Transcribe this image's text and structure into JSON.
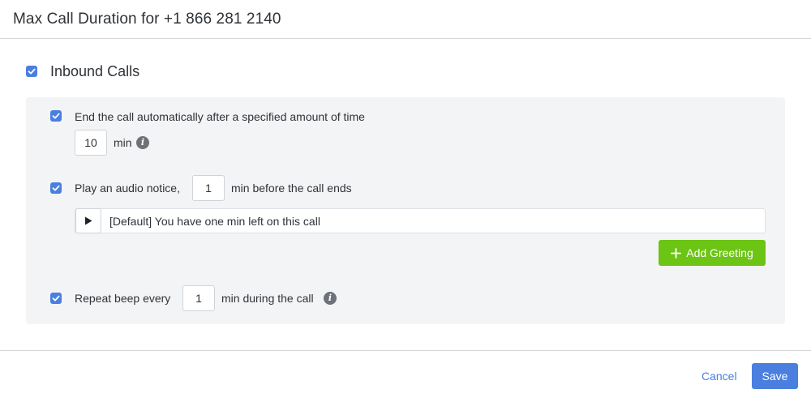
{
  "dialog": {
    "title": "Max Call Duration for +1 866 281 2140"
  },
  "inbound": {
    "label": "Inbound Calls",
    "checked": true
  },
  "end_call": {
    "label": "End the call automatically after a specified amount of time",
    "checked": true,
    "value": "10",
    "unit": "min"
  },
  "audio_notice": {
    "label_before": "Play an audio notice,",
    "value": "1",
    "label_after": "min before the call ends",
    "checked": true,
    "greeting": "[Default] You have one min left on this call",
    "add_greeting_label": "Add Greeting"
  },
  "repeat_beep": {
    "label_before": "Repeat beep every",
    "value": "1",
    "label_after": "min during the call",
    "checked": true
  },
  "footer": {
    "cancel_label": "Cancel",
    "save_label": "Save"
  },
  "icons": {
    "checkbox": "check-icon",
    "info": "info-icon",
    "play": "play-icon",
    "add": "plus-icon"
  },
  "colors": {
    "accent": "#4a7fe0",
    "success": "#6cc414",
    "panel": "#f3f4f6"
  }
}
